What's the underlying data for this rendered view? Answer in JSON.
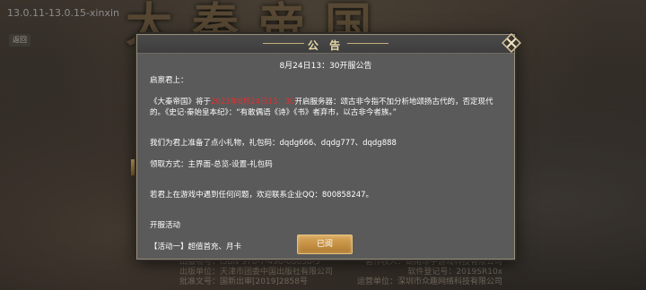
{
  "background": {
    "version": "13.0.11-13.0.15-xinxin",
    "title_chars": "大秦帝国",
    "back_chip": "返回",
    "footer_rows": [
      [
        "出版物号：ISBN 978-7-498-08658-3",
        "著作权人：湖南琼宇游戏科技有限公司"
      ],
      [
        "出版单位：天津市团委中国出版社有限公司",
        "软件登记号：2019SR10x"
      ],
      [
        "批准文号：国新出审[2019]2858号",
        "运营单位：深圳市众趣网络科技有限公司"
      ]
    ]
  },
  "dialog": {
    "title": "公  告",
    "subtitle": "8月24日13：30开服公告",
    "greeting": "启禀君上：",
    "para1_a": "《大秦帝国》将于",
    "para1_red": "2023年8月24日13：30",
    "para1_b": "开启服务器：颂古非今指不加分析地颂扬古代的，否定现代的。《史记·秦始皇本纪》：“有敢偶语《诗》《书》者弃市，以古非今者族。”",
    "gift_line": "我们为君上准备了点小礼物，礼包码：dqdg666、dqdg777、dqdg888",
    "claim_line": "领取方式：主界面-总览-设置-礼包码",
    "contact_line": "若君上在游戏中遇到任何问题，欢迎联系企业QQ：800858247。",
    "events_title": "开服活动",
    "event1": "【活动一】超值首充、月卡",
    "confirm_label": "已阅"
  },
  "colors": {
    "title": "#e8d9a8",
    "highlight_red": "#e22f2f",
    "button_gold": "#c98f42",
    "dialog_bg": "#5a5a5a"
  },
  "icons": {
    "close": "close-x-icon"
  }
}
